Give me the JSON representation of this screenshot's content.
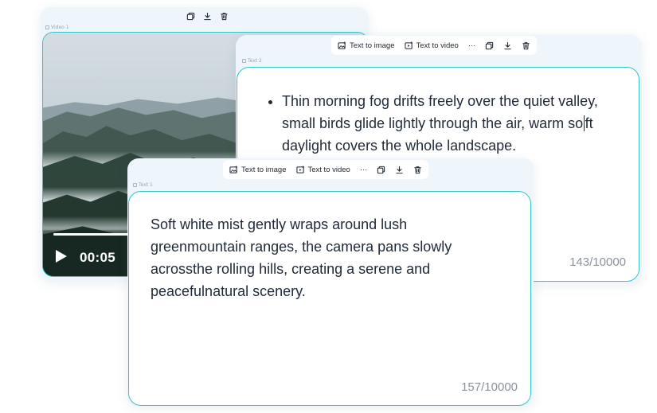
{
  "nodes": {
    "video": {
      "tag": "Video 1",
      "time": "00:05",
      "progress": 0.66
    },
    "text2": {
      "tag": "Text 2",
      "toolbar": {
        "text_to_image": "Text to image",
        "text_to_video": "Text to video",
        "more": "···"
      },
      "content_before_caret": "Thin morning fog drifts freely over the quiet valley, small birds glide lightly through the air, warm so",
      "content_after_caret": "ft daylight covers the whole landscape.",
      "counter": "143/10000"
    },
    "text1": {
      "tag": "Text 1",
      "toolbar": {
        "text_to_image": "Text to image",
        "text_to_video": "Text to video",
        "more": "···"
      },
      "content": "Soft white mist gently wraps around lush greenmountain ranges, the camera pans slowly acrossthe rolling hills, creating a serene and peacefulnatural scenery.",
      "counter": "157/10000"
    }
  },
  "icons": {
    "copy": "copy-icon",
    "download": "download-icon",
    "delete": "trash-icon",
    "text_to_image": "image-plus-icon",
    "text_to_video": "video-plus-icon",
    "play": "play-icon"
  },
  "colors": {
    "accent": "#33c4c8",
    "panel": "#eef6fb",
    "text": "#1f2937",
    "muted": "#8a939c"
  }
}
